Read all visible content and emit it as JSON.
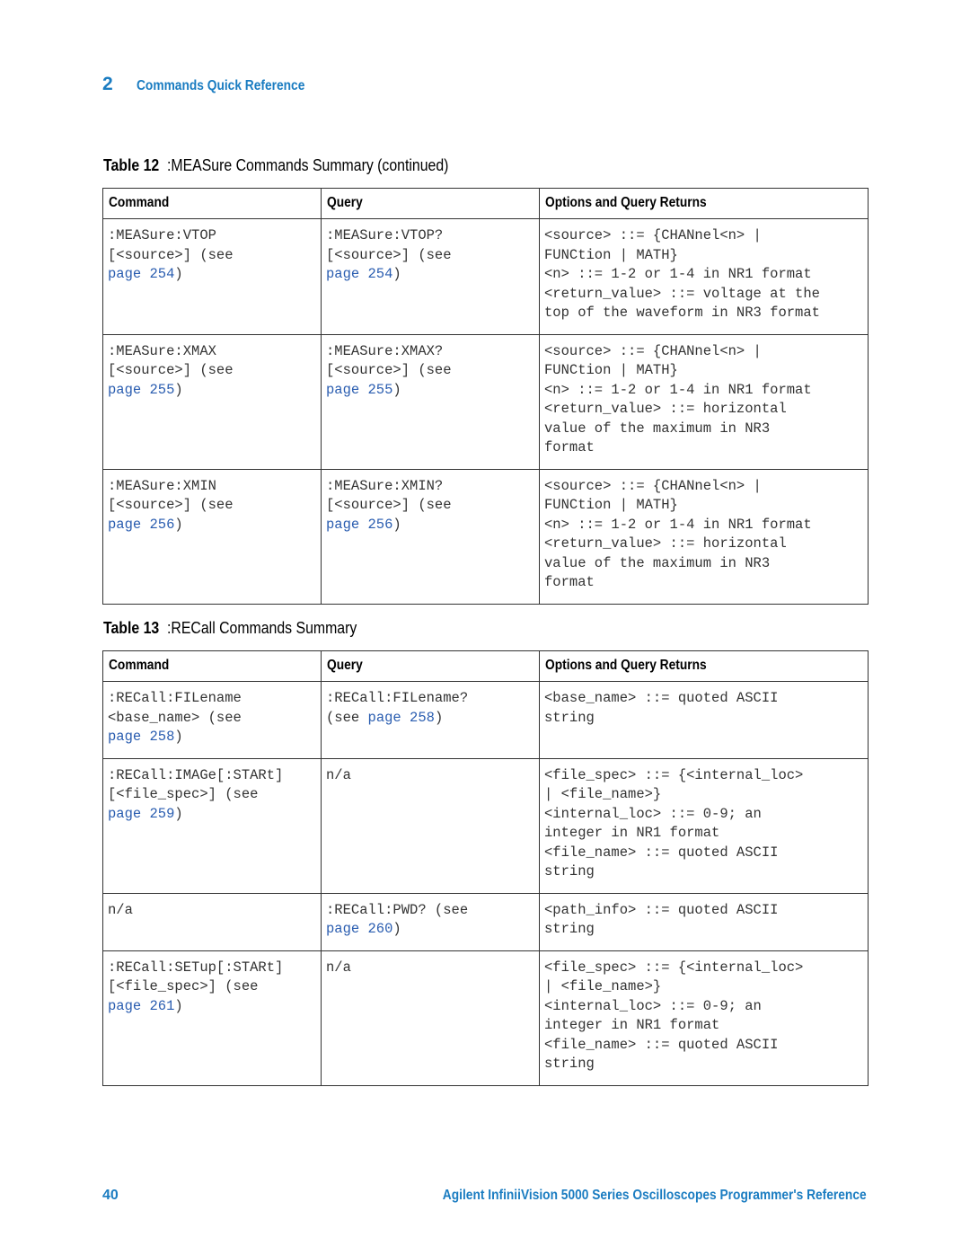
{
  "header": {
    "chapter_number": "2",
    "chapter_title": "Commands Quick Reference"
  },
  "table12": {
    "label": "Table 12",
    "title": ":MEASure Commands Summary (continued)",
    "columns": [
      "Command",
      "Query",
      "Options and Query Returns"
    ],
    "rows": [
      {
        "command": [
          ":MEASure:VTOP",
          "[<source>] (see"
        ],
        "command_link": "page 254",
        "query": [
          ":MEASure:VTOP?",
          "[<source>] (see"
        ],
        "query_link": "page 254",
        "options": [
          "<source> ::= {CHANnel<n> |",
          "FUNCtion | MATH}",
          "<n> ::= 1-2 or 1-4 in NR1 format",
          "<return_value> ::= voltage at the",
          "top of the waveform in NR3 format"
        ]
      },
      {
        "command": [
          ":MEASure:XMAX",
          "[<source>] (see"
        ],
        "command_link": "page 255",
        "query": [
          ":MEASure:XMAX?",
          "[<source>] (see"
        ],
        "query_link": "page 255",
        "options": [
          "<source> ::= {CHANnel<n> |",
          "FUNCtion | MATH}",
          "<n> ::= 1-2 or 1-4 in NR1 format",
          "<return_value> ::= horizontal",
          "value of the maximum in NR3",
          "format"
        ]
      },
      {
        "command": [
          ":MEASure:XMIN",
          "[<source>] (see"
        ],
        "command_link": "page 256",
        "query": [
          ":MEASure:XMIN?",
          "[<source>] (see"
        ],
        "query_link": "page 256",
        "options": [
          "<source> ::= {CHANnel<n> |",
          "FUNCtion | MATH}",
          "<n> ::= 1-2 or 1-4 in NR1 format",
          "<return_value> ::= horizontal",
          "value of the maximum in NR3",
          "format"
        ]
      }
    ]
  },
  "table13": {
    "label": "Table 13",
    "title": ":RECall Commands Summary",
    "columns": [
      "Command",
      "Query",
      "Options and Query Returns"
    ],
    "rows": [
      {
        "command": [
          ":RECall:FILename",
          "<base_name> (see"
        ],
        "command_link": "page 258",
        "query": [
          ":RECall:FILename?",
          "(see "
        ],
        "query_link": "page 258",
        "options": [
          "<base_name> ::= quoted ASCII",
          "string"
        ]
      },
      {
        "command": [
          ":RECall:IMAGe[:STARt]",
          "[<file_spec>] (see"
        ],
        "command_link": "page 259",
        "query": [
          "n/a"
        ],
        "query_link": "",
        "options": [
          "<file_spec> ::= {<internal_loc>",
          "| <file_name>}",
          "<internal_loc> ::= 0-9; an",
          "integer in NR1 format",
          "<file_name> ::= quoted ASCII",
          "string"
        ]
      },
      {
        "command": [
          "n/a"
        ],
        "command_link": "",
        "query": [
          ":RECall:PWD? (see"
        ],
        "query_link": "page 260",
        "options": [
          "<path_info> ::= quoted ASCII",
          "string"
        ]
      },
      {
        "command": [
          ":RECall:SETup[:STARt]",
          "[<file_spec>] (see"
        ],
        "command_link": "page 261",
        "query": [
          "n/a"
        ],
        "query_link": "",
        "options": [
          "<file_spec> ::= {<internal_loc>",
          "| <file_name>}",
          "<internal_loc> ::= 0-9; an",
          "integer in NR1 format",
          "<file_name> ::= quoted ASCII",
          "string"
        ]
      }
    ]
  },
  "footer": {
    "page_number": "40",
    "book_title": "Agilent InfiniiVision 5000 Series Oscilloscopes Programmer's Reference"
  },
  "colors": {
    "accent": "#1a7cc1",
    "link": "#2a5db0"
  }
}
